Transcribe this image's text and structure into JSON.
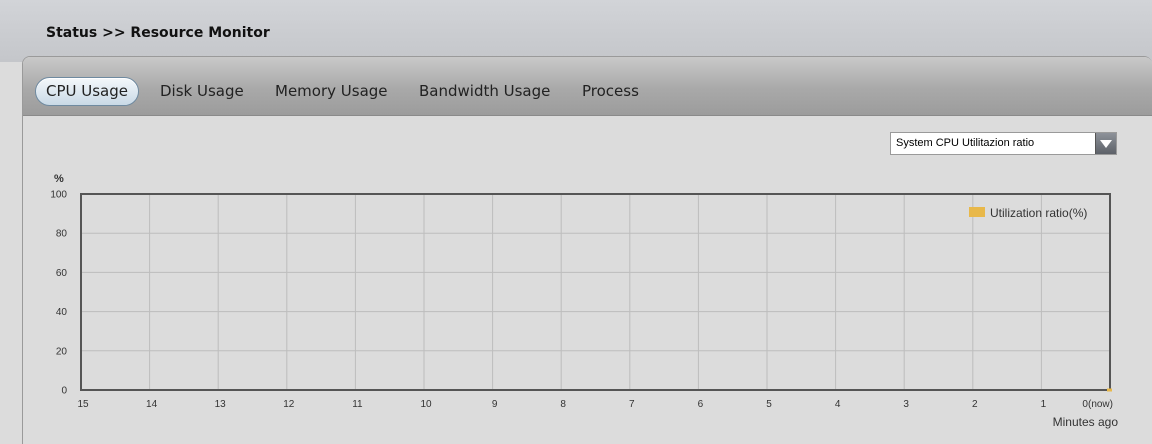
{
  "header": {
    "title": "Status >> Resource Monitor"
  },
  "tabs": [
    {
      "label": "CPU Usage",
      "active": true
    },
    {
      "label": "Disk Usage",
      "active": false
    },
    {
      "label": "Memory Usage",
      "active": false
    },
    {
      "label": "Bandwidth Usage",
      "active": false
    },
    {
      "label": "Process",
      "active": false
    }
  ],
  "metric_select": {
    "selected": "System CPU Utilitazion ratio"
  },
  "colors": {
    "series": "#e8b84a",
    "grid": "#bdbdbd",
    "axis": "#555555"
  },
  "chart_data": {
    "type": "line",
    "ylabel": "%",
    "xlabel": "Minutes ago",
    "x_ticks": [
      "15",
      "14",
      "13",
      "12",
      "11",
      "10",
      "9",
      "8",
      "7",
      "6",
      "5",
      "4",
      "3",
      "2",
      "1",
      "0(now)"
    ],
    "y_ticks": [
      "100",
      "80",
      "60",
      "40",
      "20",
      "0"
    ],
    "ylim": [
      0,
      100
    ],
    "xlim": [
      15,
      0
    ],
    "grid": true,
    "legend_position": "top-right",
    "series": [
      {
        "name": "Utilization ratio(%)",
        "x": [
          0
        ],
        "y": [
          0
        ]
      }
    ]
  }
}
